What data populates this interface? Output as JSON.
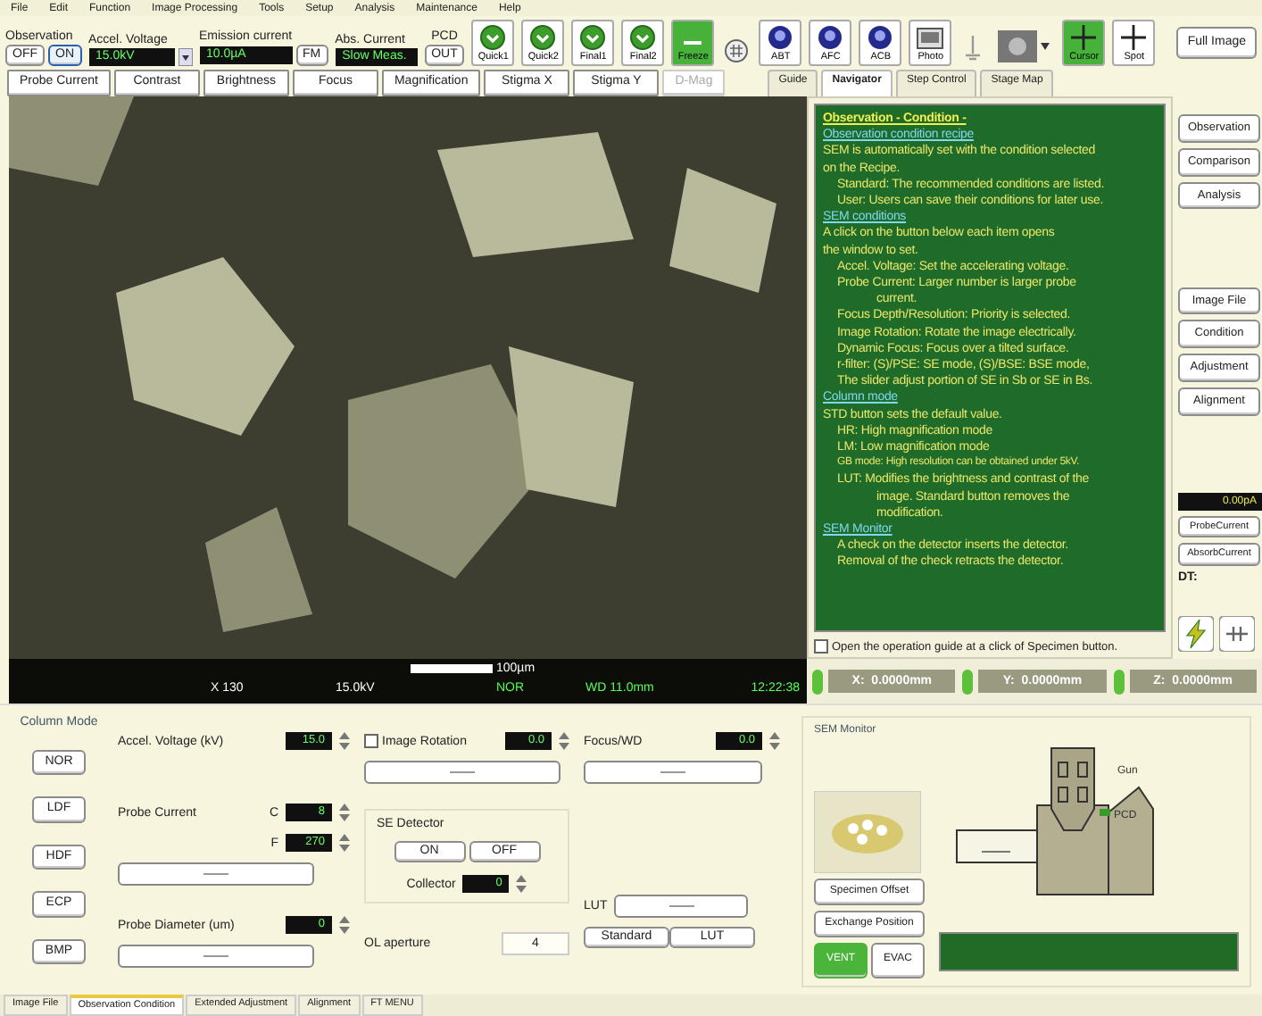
{
  "menu_bar": [
    "File",
    "Edit",
    "Function",
    "Image Processing",
    "Tools",
    "Setup",
    "Analysis",
    "Maintenance",
    "Help"
  ],
  "toolbar": {
    "observation": {
      "label": "Observation",
      "buttons": [
        {
          "label": "OFF",
          "selected": false
        },
        {
          "label": "ON",
          "selected": true
        }
      ]
    },
    "accel_voltage": {
      "label": "Accel. Voltage",
      "value": "15.0kV"
    },
    "emission_current": {
      "label": "Emission current",
      "value": "10.0µA",
      "button": "FM"
    },
    "abs_current": {
      "label": "Abs. Current",
      "value": "Slow Meas."
    },
    "pcd": {
      "label": "PCD",
      "button": "OUT"
    },
    "tools": [
      {
        "kind": "green-round",
        "label": "Quick1"
      },
      {
        "kind": "green-round",
        "label": "Quick2"
      },
      {
        "kind": "green-round",
        "label": "Final1"
      },
      {
        "kind": "green-round",
        "label": "Final2"
      },
      {
        "kind": "freeze",
        "label": "Freeze",
        "on": true
      },
      {
        "kind": "grid"
      },
      {
        "kind": "blue-round",
        "label": "ABT"
      },
      {
        "kind": "blue-round",
        "label": "AFC"
      },
      {
        "kind": "blue-round",
        "label": "ACB"
      },
      {
        "kind": "photo",
        "label": "Photo"
      },
      {
        "kind": "pin"
      },
      {
        "kind": "thumbnail"
      },
      {
        "kind": "cursor",
        "label": "Cursor",
        "on": true
      },
      {
        "kind": "spot",
        "label": "Spot",
        "on": false
      }
    ],
    "full_image": "Full Image"
  },
  "adjust_buttons": [
    {
      "label": "Probe Current",
      "disabled": false
    },
    {
      "label": "Contrast",
      "disabled": false
    },
    {
      "label": "Brightness",
      "disabled": false
    },
    {
      "label": "Focus",
      "disabled": false
    },
    {
      "label": "Magnification",
      "disabled": false
    },
    {
      "label": "Stigma X",
      "disabled": false
    },
    {
      "label": "Stigma Y",
      "disabled": false
    },
    {
      "label": "D-Mag",
      "disabled": true
    }
  ],
  "guide_tabs": [
    {
      "label": "Guide",
      "selected": false
    },
    {
      "label": "Navigator",
      "selected": true
    },
    {
      "label": "Step Control",
      "selected": false
    },
    {
      "label": "Stage Map",
      "selected": false
    }
  ],
  "viewer": {
    "scale_label": "100µm",
    "magnification": "X 130",
    "voltage": "15.0kV",
    "mode": "NOR",
    "working_distance": "WD 11.0mm",
    "time": "12:22:38"
  },
  "guide": {
    "lines": [
      {
        "kind": "heading",
        "text": "Observation - Condition -"
      },
      {
        "kind": "link",
        "text": "Observation condition recipe"
      },
      {
        "kind": "text",
        "text": "SEM is automatically set with the condition selected"
      },
      {
        "kind": "text",
        "text": "on the Recipe."
      },
      {
        "kind": "item",
        "text": "Standard: The recommended conditions are listed."
      },
      {
        "kind": "item",
        "text": "User: Users can save their conditions for later use."
      },
      {
        "kind": "link",
        "text": "SEM conditions"
      },
      {
        "kind": "text",
        "text": "A click on the button below each item opens"
      },
      {
        "kind": "text",
        "text": "the window to set."
      },
      {
        "kind": "item",
        "text": "Accel. Voltage: Set the accelerating voltage."
      },
      {
        "kind": "item",
        "text": "Probe Current: Larger number is larger probe"
      },
      {
        "kind": "cont",
        "text": "current."
      },
      {
        "kind": "item",
        "text": "Focus Depth/Resolution: Priority is selected."
      },
      {
        "kind": "item",
        "text": "Image Rotation: Rotate the image electrically."
      },
      {
        "kind": "item",
        "text": "Dynamic Focus: Focus over a tilted surface."
      },
      {
        "kind": "item",
        "text": "r-filter: (S)/PSE: SE mode, (S)/BSE: BSE mode,"
      },
      {
        "kind": "item",
        "text": "The slider adjust portion of SE in Sb or SE in Bs."
      },
      {
        "kind": "link",
        "text": "Column mode"
      },
      {
        "kind": "text",
        "text": "STD button sets the default value."
      },
      {
        "kind": "item",
        "text": "HR: High magnification mode"
      },
      {
        "kind": "item",
        "text": "LM: Low magnification mode"
      },
      {
        "kind": "small",
        "text": "GB mode: High resolution can be obtained under 5kV."
      },
      {
        "kind": "item",
        "text": "LUT: Modifies the brightness and contrast of the"
      },
      {
        "kind": "cont",
        "text": "image. Standard button removes the"
      },
      {
        "kind": "cont",
        "text": "modification."
      },
      {
        "kind": "link",
        "text": "SEM Monitor"
      },
      {
        "kind": "item",
        "text": "A check on the detector inserts the detector."
      },
      {
        "kind": "item",
        "text": "Removal of the check retracts the detector."
      }
    ],
    "option": {
      "label": "Open the operation guide at a click of Specimen button.",
      "checked": false
    }
  },
  "side_panel": {
    "upper_buttons": [
      "Observation",
      "Comparison",
      "Analysis"
    ],
    "lower_buttons": [
      "Image File",
      "Condition",
      "Adjustment",
      "Alignment"
    ],
    "readout": "0.00pA",
    "current_buttons": [
      {
        "label": "ProbeCurrent",
        "selected": false
      },
      {
        "label": "AbsorbCurrent",
        "selected": false
      }
    ],
    "dt_label": "DT:"
  },
  "stage": [
    {
      "axis": "X:",
      "value": "0.0000mm"
    },
    {
      "axis": "Y:",
      "value": "0.0000mm"
    },
    {
      "axis": "Z:",
      "value": "0.0000mm"
    }
  ],
  "column_mode": {
    "title": "Column Mode",
    "buttons": [
      "NOR",
      "LDF",
      "HDF",
      "ECP",
      "BMP"
    ]
  },
  "settings": {
    "accel_voltage": {
      "label": "Accel. Voltage (kV)",
      "value": "15.0"
    },
    "probe_current": {
      "label": "Probe Current",
      "coarse_label": "C",
      "coarse": "8",
      "fine_label": "F",
      "fine": "270",
      "level": 0.5
    },
    "probe_diameter": {
      "label": "Probe Diameter (um)",
      "value": "0",
      "level": 0.5
    },
    "image_rotation": {
      "label": "Image Rotation",
      "checked": false,
      "value": "0.0",
      "level": 0.5
    },
    "se_detector": {
      "title": "SE Detector",
      "on": "ON",
      "off": "OFF",
      "collector_label": "Collector",
      "collector": "0"
    },
    "ol_aperture": {
      "label": "OL aperture",
      "value": "4"
    },
    "focus_wd": {
      "label": "Focus/WD",
      "value": "0.0",
      "level": 0.5
    },
    "lut": {
      "label": "LUT",
      "level": 0.5,
      "buttons": [
        "Standard",
        "LUT"
      ]
    }
  },
  "sem_monitor": {
    "title": "SEM Monitor",
    "buttons": [
      "Specimen Offset",
      "Exchange Position"
    ],
    "vacuum": [
      {
        "label": "VENT",
        "selected": true
      },
      {
        "label": "EVAC",
        "selected": false
      }
    ],
    "gun_label": "Gun",
    "pcd_label": "PCD"
  },
  "bottom_tabs": [
    {
      "label": "Image File",
      "selected": false
    },
    {
      "label": "Observation Condition",
      "selected": true
    },
    {
      "label": "Extended Adjustment",
      "selected": false
    },
    {
      "label": "Alignment",
      "selected": false
    },
    {
      "label": "FT MENU",
      "selected": false
    }
  ]
}
